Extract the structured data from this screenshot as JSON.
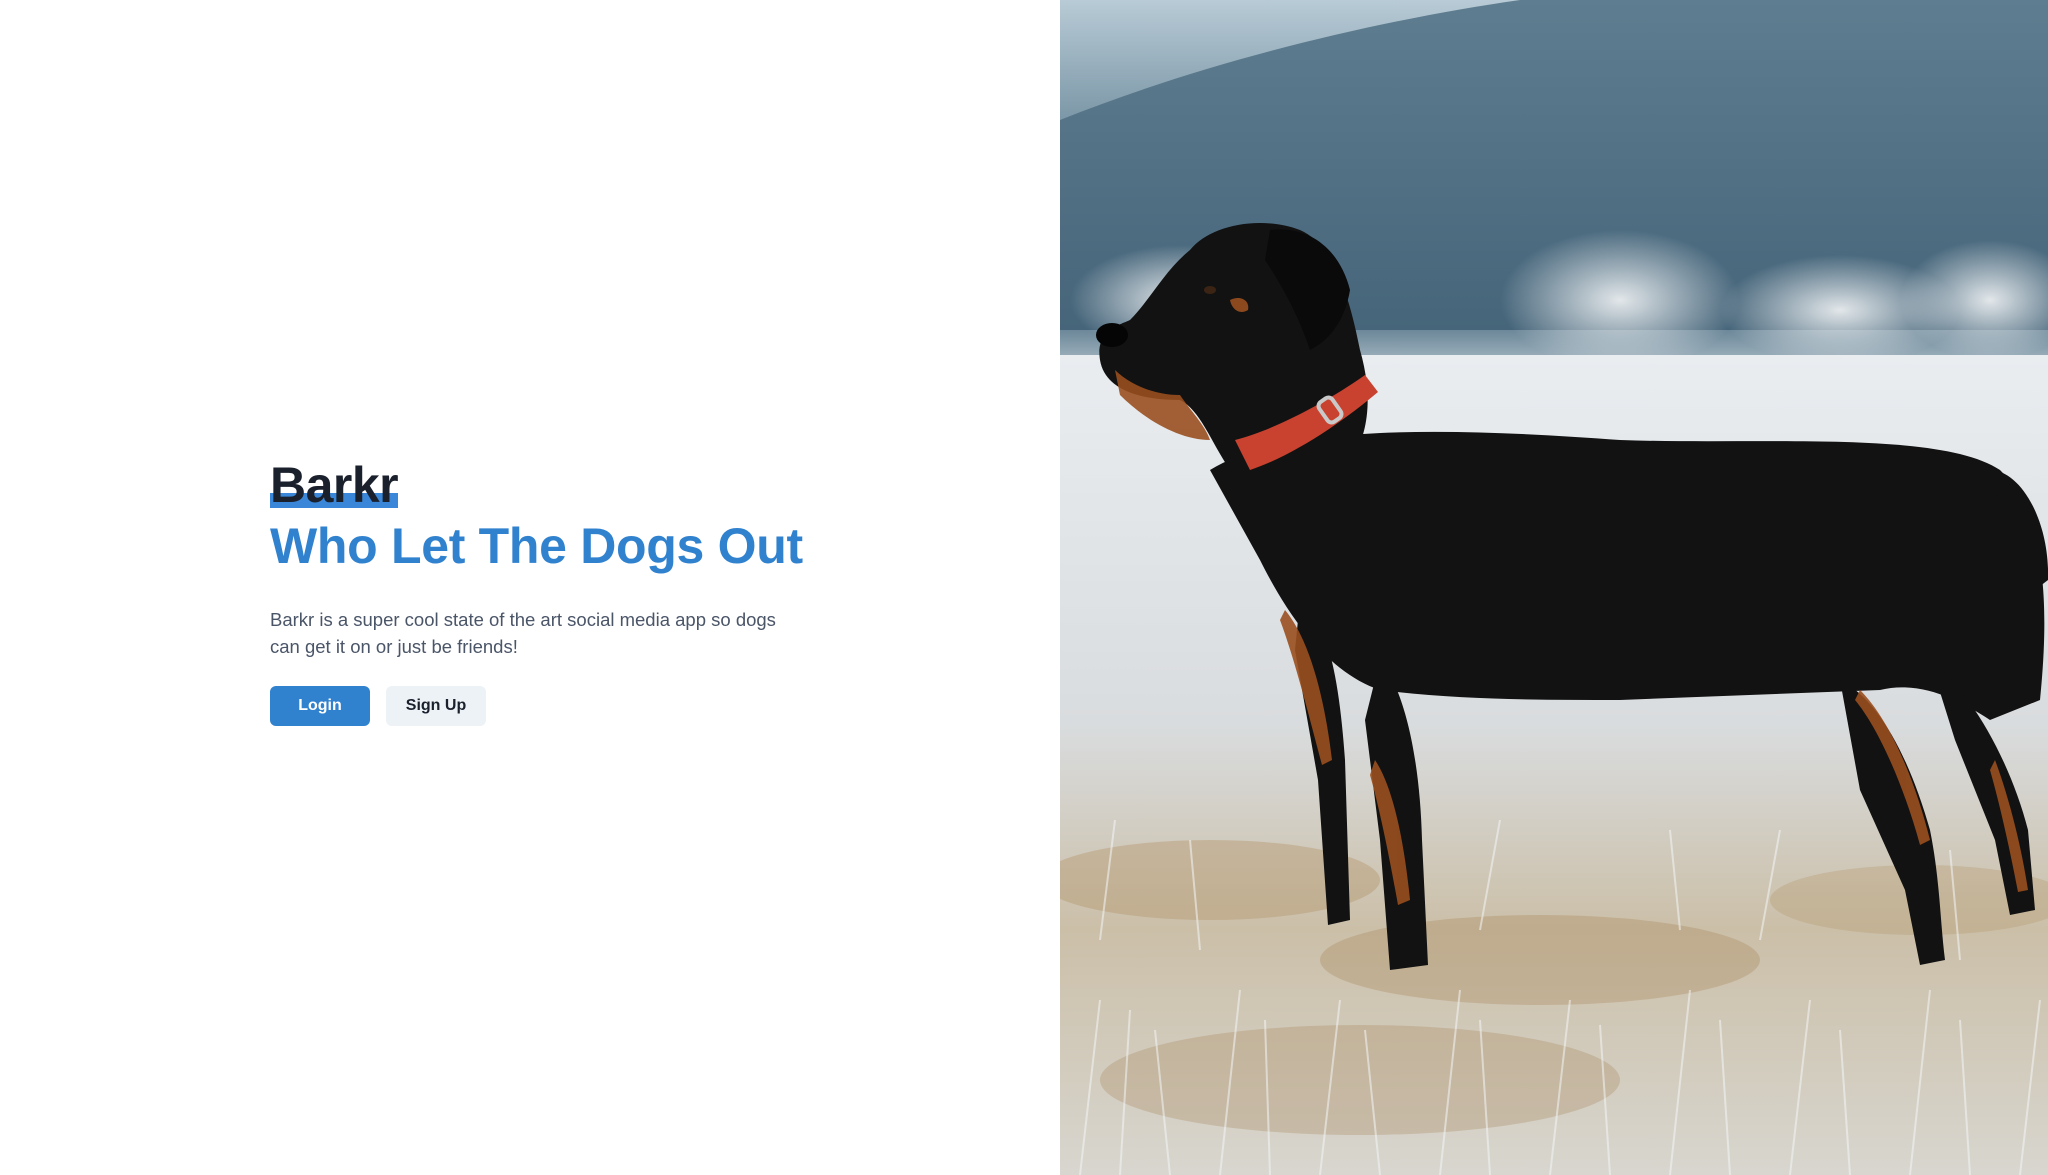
{
  "brand": {
    "name": "Barkr",
    "accent_color": "#3182ce"
  },
  "hero": {
    "tagline": "Who Let The Dogs Out",
    "description": "Barkr is a super cool state of the art social media app so dogs can get it on or just be friends!"
  },
  "actions": {
    "login_label": "Login",
    "signup_label": "Sign Up"
  },
  "image": {
    "subject": "rottweiler-standing-in-frosty-field"
  }
}
